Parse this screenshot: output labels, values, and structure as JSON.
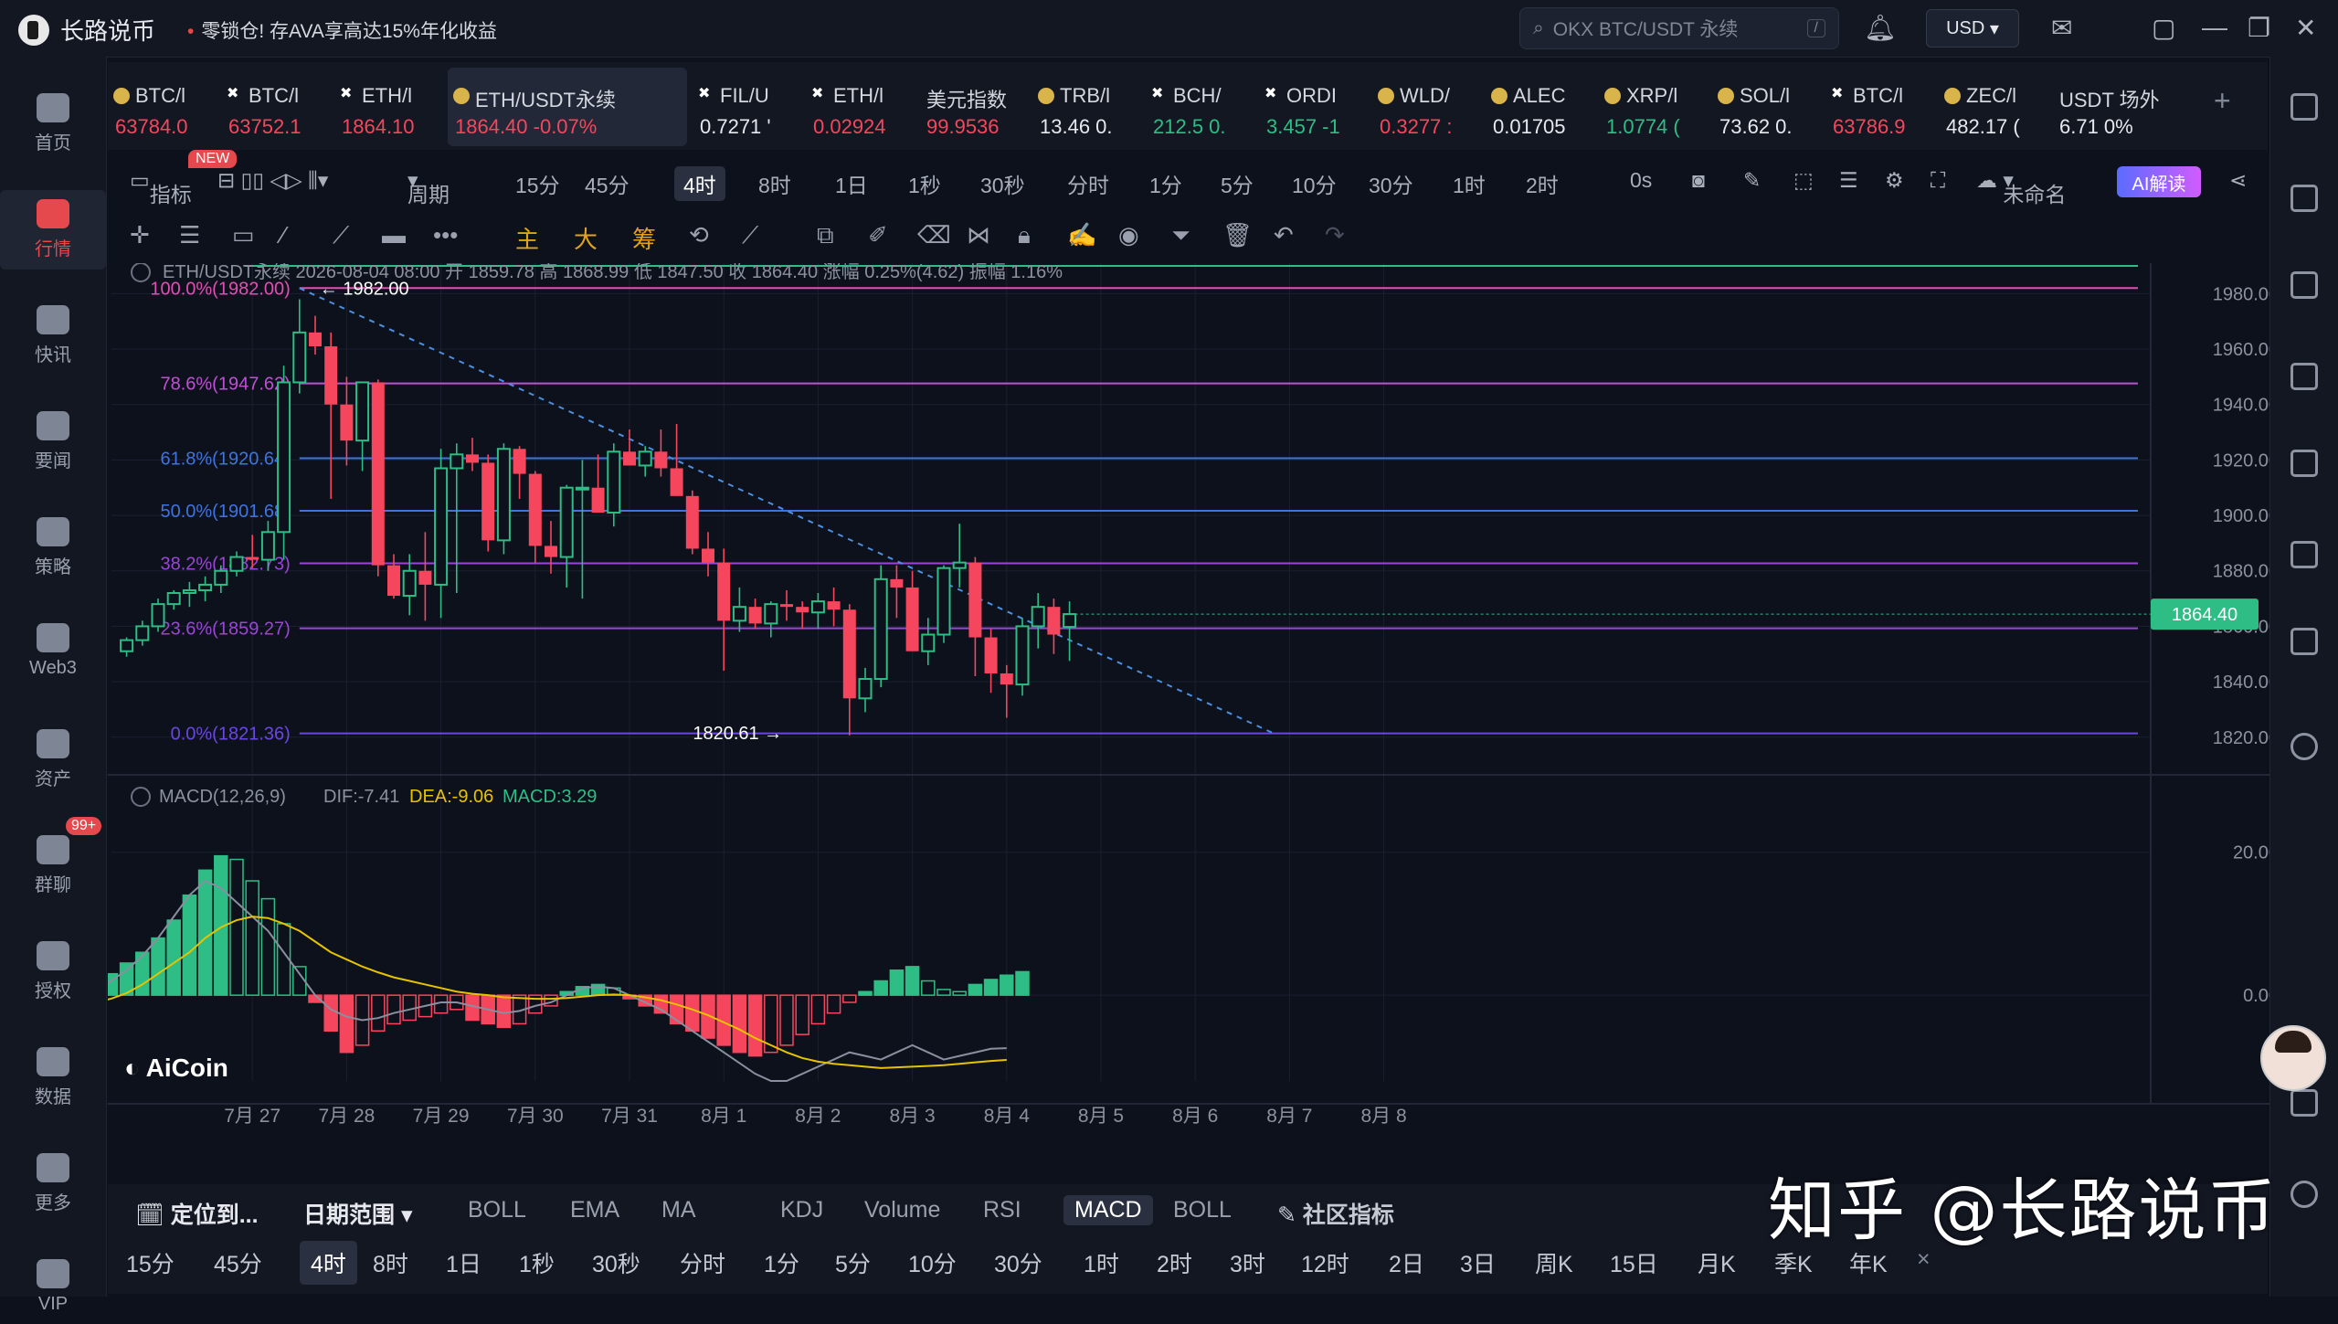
{
  "app": {
    "brand": "长路说币",
    "promo": "零锁仓! 存AVA享高达15%年化收益",
    "search_placeholder": "OKX BTC/USDT 永续",
    "search_shortcut": "/",
    "currency": "USD"
  },
  "left_nav": [
    {
      "label": "首页",
      "icon": "compass-icon"
    },
    {
      "label": "行情",
      "icon": "chart-bar-icon",
      "active": true
    },
    {
      "label": "快讯",
      "icon": "news-icon"
    },
    {
      "label": "要闻",
      "icon": "document-icon"
    },
    {
      "label": "策略",
      "icon": "robot-icon"
    },
    {
      "label": "Web3",
      "icon": "web3-icon"
    },
    {
      "label": "资产",
      "icon": "wallet-icon"
    },
    {
      "label": "群聊",
      "icon": "chat-icon",
      "badge": "99+"
    },
    {
      "label": "授权",
      "icon": "key-icon"
    },
    {
      "label": "数据",
      "icon": "data-icon"
    },
    {
      "label": "更多",
      "icon": "grid-icon"
    },
    {
      "label": "VIP",
      "icon": "diamond-icon"
    }
  ],
  "tickers": [
    {
      "name": "BTC/l",
      "price": "63784.0",
      "dir": "dn",
      "icon": "coin"
    },
    {
      "name": "BTC/l",
      "price": "63752.1",
      "dir": "dn",
      "icon": "x"
    },
    {
      "name": "ETH/l",
      "price": "1864.10",
      "dir": "dn",
      "icon": "x"
    },
    {
      "name": "ETH/USDT永续",
      "price": "1864.40  -0.07%",
      "dir": "dn",
      "icon": "coin",
      "selected": true
    },
    {
      "name": "FIL/U",
      "price": "0.7271 '",
      "dir": "wh",
      "icon": "x"
    },
    {
      "name": "ETH/l",
      "price": "0.02924",
      "dir": "dn",
      "icon": "x"
    },
    {
      "name": "美元指数",
      "price": "99.9536",
      "dir": "dn",
      "icon": "none"
    },
    {
      "name": "TRB/l",
      "price": "13.46  0.",
      "dir": "wh",
      "icon": "coin"
    },
    {
      "name": "BCH/",
      "price": "212.5  0.",
      "dir": "up",
      "icon": "x"
    },
    {
      "name": "ORDI",
      "price": "3.457  -1",
      "dir": "up",
      "icon": "x"
    },
    {
      "name": "WLD/",
      "price": "0.3277  :",
      "dir": "dn",
      "icon": "coin"
    },
    {
      "name": "ALEC",
      "price": "0.01705",
      "dir": "wh",
      "icon": "coin"
    },
    {
      "name": "XRP/l",
      "price": "1.0774  (",
      "dir": "up",
      "icon": "coin"
    },
    {
      "name": "SOL/l",
      "price": "73.62  0.",
      "dir": "wh",
      "icon": "coin"
    },
    {
      "name": "BTC/l",
      "price": "63786.9",
      "dir": "dn",
      "icon": "x"
    },
    {
      "name": "ZEC/l",
      "price": "482.17  (",
      "dir": "wh",
      "icon": "coin"
    },
    {
      "name": "USDT 场外",
      "price": "6.71  0%",
      "dir": "wh",
      "icon": "none"
    }
  ],
  "new_tag": "NEW",
  "toolbar": {
    "indicator": "指标",
    "period": "周期",
    "intervals": [
      "15分",
      "45分",
      "4时",
      "8时",
      "1日",
      "1秒",
      "30秒",
      "分时",
      "1分",
      "5分",
      "10分",
      "30分",
      "1时",
      "2时",
      "0s"
    ],
    "active_interval": "4时",
    "unnamed": "未命名",
    "ai": "AI解读"
  },
  "drawing_tools": {
    "main": "主",
    "big": "大",
    "chips": "筹"
  },
  "chart_header": "ETH/USDT永续  2026-08-04 08:00  开 1859.78  高 1868.99  低 1847.50  收 1864.40  涨幅 0.25%(4.62)  振幅 1.16%",
  "macd_header": {
    "name": "MACD(12,26,9)",
    "dif": "DIF:-7.41",
    "dea": "DEA:-9.06",
    "macd": "MACD:3.29"
  },
  "aicoin_logo": "AiCoin",
  "chart_data": {
    "type": "candlestick",
    "symbol": "ETH/USDT永续",
    "y_ticks": [
      1820,
      1840,
      1860,
      1880,
      1900,
      1920,
      1940,
      1960,
      1980
    ],
    "y_tick_labels": [
      "1820.00",
      "1840.00",
      "1860.00",
      "1880.00",
      "1900.00",
      "1920.00",
      "1940.00",
      "1960.00",
      "1980.00"
    ],
    "ylim": [
      1813,
      1991
    ],
    "x_labels": [
      "7月 27",
      "7月 28",
      "7月 29",
      "7月 30",
      "7月 31",
      "8月 1",
      "8月 2",
      "8月 3",
      "8月 4",
      "8月 5",
      "8月 6",
      "8月 7",
      "8月 8"
    ],
    "x_label_index": [
      8,
      14,
      20,
      26,
      32,
      38,
      44,
      50,
      56,
      62,
      68,
      74,
      80
    ],
    "last_price": "1864.40",
    "last_price_value": 1864.4,
    "fib_levels": [
      {
        "label": "100.0%(1982.00)",
        "value": 1982.0,
        "color": "#e24fb4"
      },
      {
        "label": "78.6%(1947.62)",
        "value": 1947.62,
        "color": "#c04fd6"
      },
      {
        "label": "61.8%(1920.64)",
        "value": 1920.64,
        "color": "#3f73e0"
      },
      {
        "label": "50.0%(1901.68)",
        "value": 1901.68,
        "color": "#3f73e0"
      },
      {
        "label": "38.2%(1882.73)",
        "value": 1882.73,
        "color": "#9b44d8"
      },
      {
        "label": "23.6%(1859.27)",
        "value": 1859.27,
        "color": "#9b44d8"
      },
      {
        "label": "0.0%(1821.36)",
        "value": 1821.36,
        "color": "#6a47e0"
      }
    ],
    "annotations": [
      {
        "text": "1982.00",
        "index": 11,
        "value": 1982.0
      },
      {
        "text": "1820.61",
        "index": 43,
        "value": 1820.61
      }
    ],
    "trendline": {
      "from": [
        11,
        1982
      ],
      "to": [
        73,
        1821.36
      ]
    },
    "candles": [
      [
        1851,
        1856,
        1849,
        1855
      ],
      [
        1855,
        1862,
        1853,
        1860
      ],
      [
        1860,
        1870,
        1858,
        1868
      ],
      [
        1868,
        1873,
        1866,
        1872
      ],
      [
        1872,
        1876,
        1867,
        1873
      ],
      [
        1873,
        1878,
        1869,
        1875
      ],
      [
        1875,
        1882,
        1872,
        1880
      ],
      [
        1880,
        1887,
        1878,
        1885
      ],
      [
        1885,
        1893,
        1881,
        1884
      ],
      [
        1884,
        1898,
        1880,
        1894
      ],
      [
        1894,
        1954,
        1884,
        1948
      ],
      [
        1948,
        1978,
        1944,
        1966
      ],
      [
        1966,
        1972,
        1958,
        1961
      ],
      [
        1961,
        1966,
        1906,
        1940
      ],
      [
        1940,
        1950,
        1918,
        1927
      ],
      [
        1927,
        1948,
        1916,
        1948
      ],
      [
        1948,
        1949,
        1878,
        1882
      ],
      [
        1882,
        1886,
        1870,
        1871
      ],
      [
        1871,
        1886,
        1864,
        1880
      ],
      [
        1880,
        1894,
        1862,
        1875
      ],
      [
        1875,
        1924,
        1863,
        1917
      ],
      [
        1917,
        1926,
        1872,
        1922
      ],
      [
        1922,
        1928,
        1916,
        1919
      ],
      [
        1919,
        1922,
        1887,
        1891
      ],
      [
        1891,
        1926,
        1886,
        1924
      ],
      [
        1924,
        1925,
        1906,
        1915
      ],
      [
        1915,
        1916,
        1883,
        1889
      ],
      [
        1889,
        1898,
        1879,
        1885
      ],
      [
        1885,
        1911,
        1874,
        1910
      ],
      [
        1910,
        1920,
        1870,
        1910
      ],
      [
        1910,
        1922,
        1902,
        1901
      ],
      [
        1901,
        1926,
        1896,
        1923
      ],
      [
        1923,
        1931,
        1918,
        1918
      ],
      [
        1918,
        1925,
        1914,
        1923
      ],
      [
        1923,
        1931,
        1914,
        1917
      ],
      [
        1917,
        1933,
        1911,
        1907
      ],
      [
        1907,
        1909,
        1886,
        1888
      ],
      [
        1888,
        1894,
        1878,
        1883
      ],
      [
        1883,
        1888,
        1844,
        1862
      ],
      [
        1862,
        1874,
        1858,
        1867
      ],
      [
        1867,
        1870,
        1859,
        1861
      ],
      [
        1861,
        1869,
        1856,
        1868
      ],
      [
        1868,
        1873,
        1862,
        1867
      ],
      [
        1867,
        1869,
        1859,
        1865
      ],
      [
        1865,
        1872,
        1859,
        1869
      ],
      [
        1869,
        1874,
        1860,
        1866
      ],
      [
        1866,
        1868,
        1820.61,
        1834
      ],
      [
        1834,
        1845,
        1829,
        1841
      ],
      [
        1841,
        1882,
        1838,
        1877
      ],
      [
        1877,
        1882,
        1863,
        1874
      ],
      [
        1874,
        1880,
        1851,
        1851
      ],
      [
        1851,
        1863,
        1846,
        1857
      ],
      [
        1857,
        1882,
        1854,
        1881
      ],
      [
        1881,
        1897,
        1874,
        1883
      ],
      [
        1883,
        1885,
        1842,
        1856
      ],
      [
        1856,
        1859,
        1836,
        1843
      ],
      [
        1843,
        1846,
        1827,
        1839
      ],
      [
        1839,
        1863,
        1835,
        1860
      ],
      [
        1860,
        1872,
        1852,
        1867
      ],
      [
        1867,
        1870,
        1850,
        1857
      ],
      [
        1859.78,
        1868.99,
        1847.5,
        1864.4
      ]
    ],
    "macd": {
      "ylim": [
        -12,
        27
      ],
      "y_ticks": [
        0,
        20
      ],
      "y_tick_labels": [
        "0.00",
        "20.00"
      ],
      "hist": [
        -3.5,
        -2.5,
        -1.5,
        -0.8,
        0.5,
        1.5,
        3,
        4.5,
        6,
        8,
        10.5,
        14,
        17.5,
        19.5,
        19,
        16,
        13.5,
        10,
        4,
        -1,
        -5,
        -8,
        -7,
        -5,
        -4,
        -3.5,
        -3,
        -2.5,
        -2,
        -3.5,
        -4,
        -4.5,
        -4,
        -2.5,
        -1.5,
        0.5,
        1.2,
        1.5,
        1,
        -0.5,
        -1.5,
        -2.5,
        -4,
        -5,
        -6,
        -7,
        -8,
        -8.5,
        -8,
        -7,
        -5.5,
        -4,
        -2.5,
        -1,
        0.5,
        2,
        3.5,
        4,
        2,
        0.8,
        0.5,
        1.5,
        2.2,
        2.8,
        3.29
      ],
      "dif": [
        -5,
        -4,
        -3,
        -2,
        -1,
        0.5,
        2,
        3.5,
        5.5,
        8,
        11,
        14,
        16,
        15,
        13,
        11,
        9,
        6,
        3,
        0,
        -2,
        -3,
        -3.5,
        -3.2,
        -2.5,
        -2,
        -1.5,
        -1,
        -1,
        -1.5,
        -2,
        -2.5,
        -2.2,
        -1.5,
        -1,
        0,
        1,
        1.2,
        1,
        0,
        -1,
        -2,
        -3.5,
        -5,
        -6.5,
        -8,
        -9.5,
        -11,
        -12,
        -12,
        -11,
        -10,
        -9,
        -8,
        -8.5,
        -9,
        -8,
        -7,
        -8,
        -9,
        -8.5,
        -8,
        -7.5,
        -7.41
      ],
      "dea": [
        -1.5,
        -1.5,
        -1.5,
        -1.4,
        -1.3,
        -1,
        -0.5,
        0.3,
        1.5,
        3,
        4.5,
        6,
        8,
        9.5,
        10.5,
        11,
        10.8,
        10,
        9,
        7.5,
        6,
        5,
        4,
        3.2,
        2.5,
        2,
        1.5,
        1,
        0.5,
        0.2,
        0,
        -0.3,
        -0.4,
        -0.5,
        -0.5,
        -0.4,
        -0.2,
        0,
        0.1,
        0,
        -0.3,
        -0.7,
        -1.3,
        -2,
        -2.8,
        -3.8,
        -4.8,
        -6,
        -7,
        -8,
        -8.8,
        -9.3,
        -9.6,
        -9.8,
        -10,
        -10.2,
        -10.1,
        -10,
        -9.9,
        -9.8,
        -9.6,
        -9.4,
        -9.2,
        -9.06
      ]
    }
  },
  "bottom_bar": {
    "locate": "定位到...",
    "range": "日期范围",
    "indicators": [
      "BOLL",
      "EMA",
      "MA",
      "KDJ",
      "Volume",
      "RSI",
      "MACD",
      "BOLL"
    ],
    "active_indicator": "MACD",
    "community": "社区指标",
    "intervals": [
      "15分",
      "45分",
      "4时",
      "8时",
      "1日",
      "1秒",
      "30秒",
      "分时",
      "1分",
      "5分",
      "10分",
      "30分",
      "1时",
      "2时",
      "3时",
      "12时",
      "2日",
      "3日",
      "周K",
      "15日",
      "月K",
      "季K",
      "年K"
    ],
    "active_interval": "4时"
  },
  "watermark": "知乎 @长路说币"
}
